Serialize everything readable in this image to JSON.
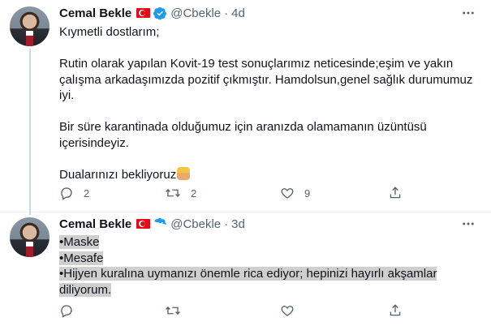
{
  "tweets": [
    {
      "author_name": "Cemal Bekle",
      "handle": "@Cbekle",
      "separator": "·",
      "time": "4d",
      "body": {
        "greeting": "Kıymetli dostlarım;",
        "p1_line1": "Rutin olarak yapılan Kovit-19 test sonuçlarımız neticesinde;eşim ve yakın",
        "p1_line2": "çalışma arkadaşımızda pozitif çıkmıştır. Hamdolsun,genel sağlık durumumuz",
        "p1_line3": "iyi.",
        "p2_line1": "Bir süre karantinada olduğumuz için aranızda olamamanın üzüntüsü",
        "p2_line2": "içerisindeyiz.",
        "closing": "Dualarınızı bekliyoruz"
      },
      "replies": "2",
      "retweets": "2",
      "likes": "9"
    },
    {
      "author_name": "Cemal Bekle",
      "handle": "@Cbekle",
      "separator": "·",
      "time": "3d",
      "body": {
        "line1": "•Maske",
        "line2": "•Mesafe",
        "line3": "•Hijyen kuralına uymanızı önemle rica ediyor; hepinizi hayırlı akşamlar",
        "line4": "diliyorum."
      }
    }
  ],
  "icons": {
    "flag": "turkey-flag-icon",
    "verified": "verified-badge-icon",
    "more": "more-options-icon",
    "reply": "reply-icon",
    "retweet": "retweet-icon",
    "like": "like-icon",
    "share": "share-icon",
    "emoji": "person-raising-hand-emoji"
  },
  "colors": {
    "verified": "#1d9bf0",
    "secondary_text": "#536471",
    "flag_red": "#e30a17",
    "highlight": "#cfcfcf"
  }
}
